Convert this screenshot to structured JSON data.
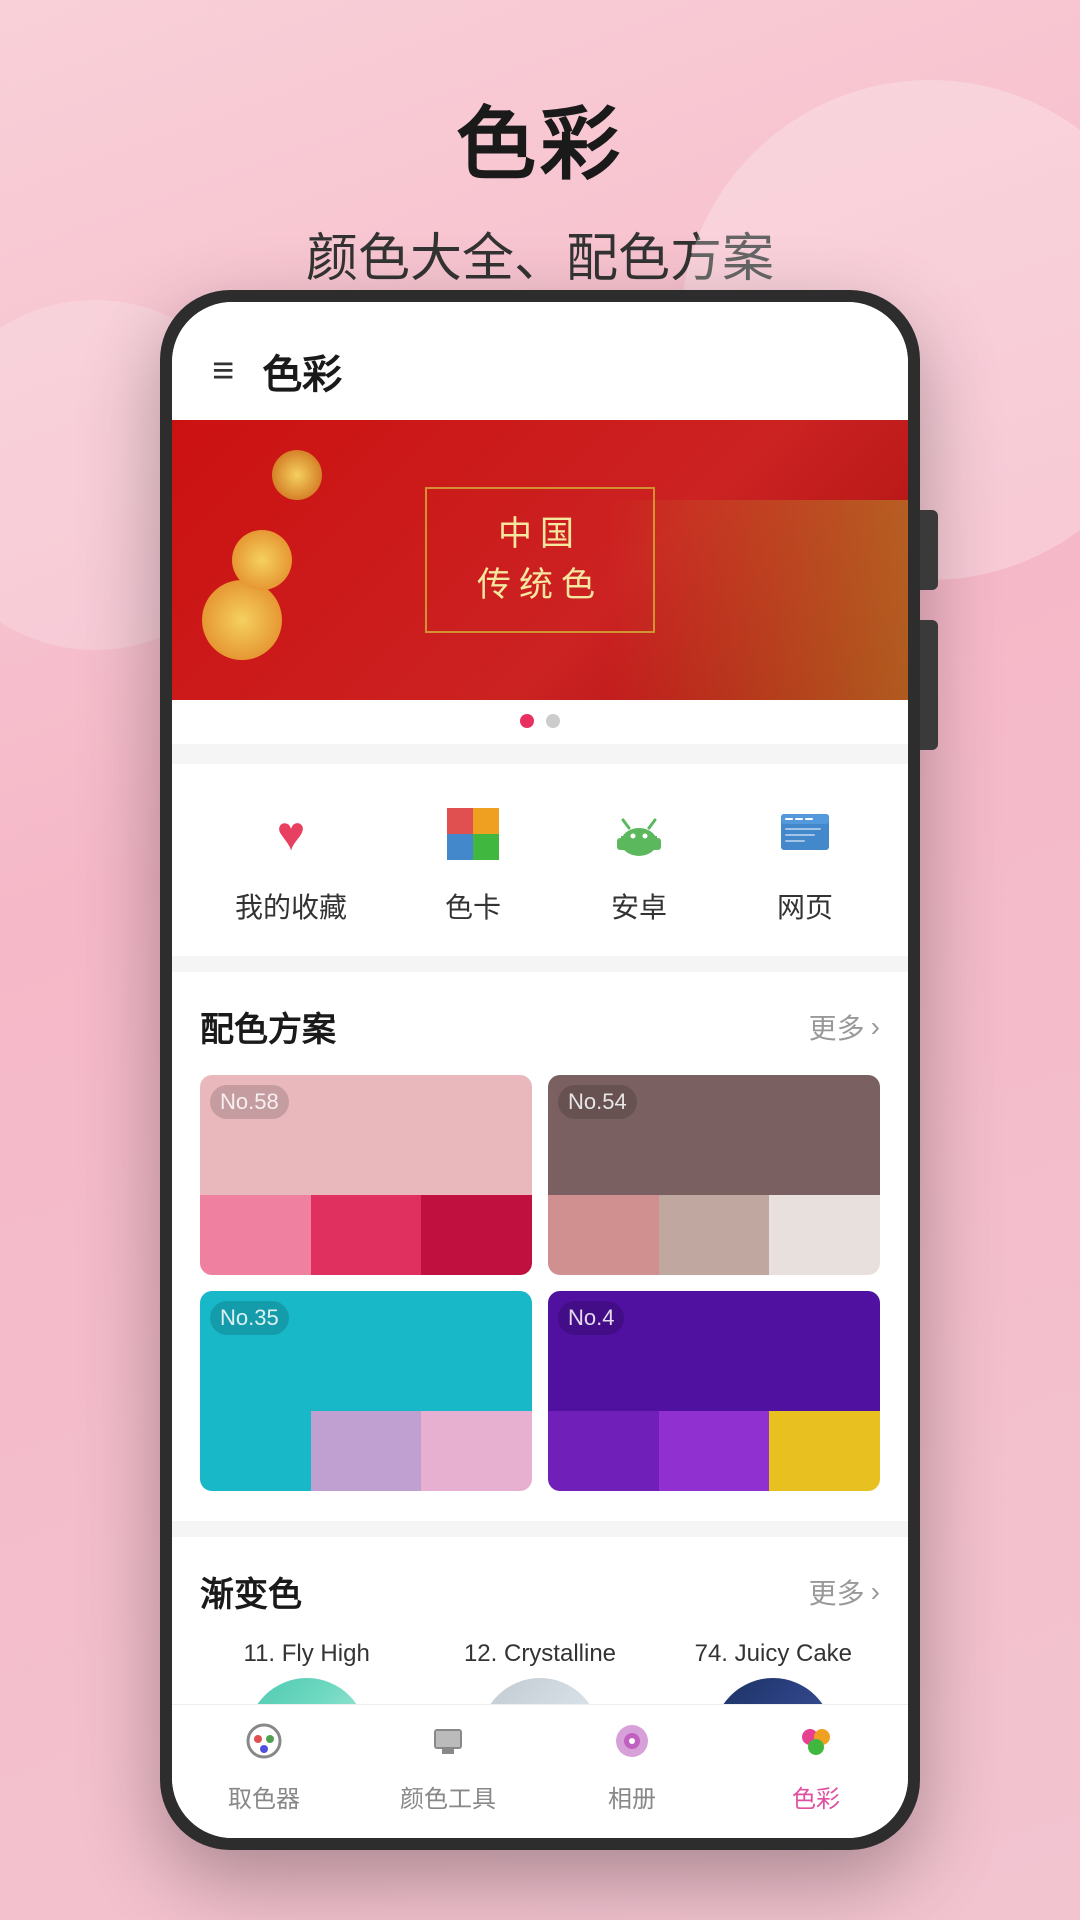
{
  "page": {
    "title": "色彩",
    "subtitle": "颜色大全、配色方案"
  },
  "appbar": {
    "title": "色彩",
    "menu_icon": "≡"
  },
  "banner": {
    "line1": "中国",
    "line2": "传统色",
    "dots": [
      true,
      false
    ]
  },
  "categories": [
    {
      "id": "favorites",
      "icon": "♥",
      "label": "我的收藏",
      "icon_type": "heart"
    },
    {
      "id": "color-card",
      "icon": "🎨",
      "label": "色卡",
      "icon_type": "palette"
    },
    {
      "id": "android",
      "icon": "🤖",
      "label": "安卓",
      "icon_type": "android"
    },
    {
      "id": "web",
      "icon": "🌐",
      "label": "网页",
      "icon_type": "web"
    }
  ],
  "palette_section": {
    "title": "配色方案",
    "more": "更多",
    "cards": [
      {
        "no": "No.58",
        "top_color": "#e8b8bc",
        "swatches": [
          "#f080a0",
          "#e03060",
          "#c01040"
        ]
      },
      {
        "no": "No.54",
        "top_color": "#7a6060",
        "swatches": [
          "#d09090",
          "#c0a8a0",
          "#e8e0dc"
        ]
      },
      {
        "no": "No.35",
        "top_color": "#18b8c8",
        "swatches": [
          "#18b8c8",
          "#c0a0d0",
          "#e8b0d0"
        ]
      },
      {
        "no": "No.4",
        "top_color": "#5010a0",
        "swatches": [
          "#7020b8",
          "#9030d0",
          "#e8c020"
        ]
      }
    ]
  },
  "gradient_section": {
    "title": "渐变色",
    "more": "更多",
    "items": [
      {
        "label": "11. Fly High",
        "gradient_class": "gc1"
      },
      {
        "label": "12. Crystalline",
        "gradient_class": "gc2"
      },
      {
        "label": "74. Juicy Cake",
        "gradient_class": "gc3"
      }
    ]
  },
  "bottom_nav": [
    {
      "id": "color-picker",
      "icon": "🎨",
      "label": "取色器",
      "active": false
    },
    {
      "id": "color-tools",
      "icon": "🧰",
      "label": "颜色工具",
      "active": false
    },
    {
      "id": "album",
      "icon": "🔮",
      "label": "相册",
      "active": false
    },
    {
      "id": "colors",
      "icon": "🌈",
      "label": "色彩",
      "active": true
    }
  ]
}
